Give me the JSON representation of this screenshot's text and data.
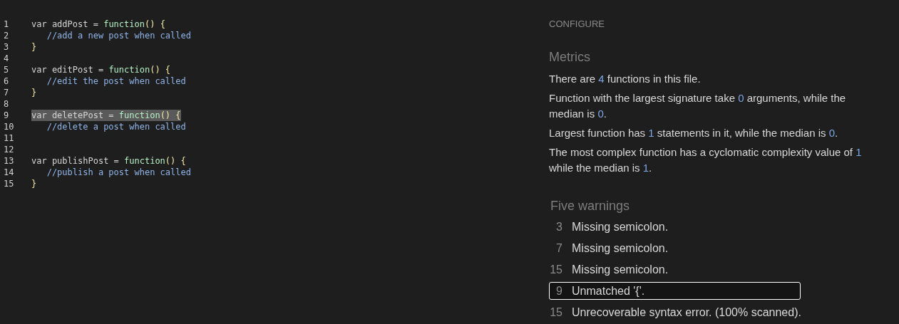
{
  "editor": {
    "lines": [
      {
        "number": "1",
        "selected": false,
        "tokens": [
          {
            "kind": "kw",
            "text": "var addPost = "
          },
          {
            "kind": "fn",
            "text": "function"
          },
          {
            "kind": "br",
            "text": "() {"
          }
        ]
      },
      {
        "number": "2",
        "selected": false,
        "tokens": [
          {
            "kind": "cm",
            "text": "   //add a new post when called"
          }
        ]
      },
      {
        "number": "3",
        "selected": false,
        "tokens": [
          {
            "kind": "br",
            "text": "}"
          }
        ]
      },
      {
        "number": "4",
        "selected": false
      },
      {
        "number": "5",
        "selected": false,
        "tokens": [
          {
            "kind": "kw",
            "text": "var editPost = "
          },
          {
            "kind": "fn",
            "text": "function"
          },
          {
            "kind": "br",
            "text": "() {"
          }
        ]
      },
      {
        "number": "6",
        "selected": false,
        "tokens": [
          {
            "kind": "cm",
            "text": "   //edit the post when called"
          }
        ]
      },
      {
        "number": "7",
        "selected": false,
        "tokens": [
          {
            "kind": "br",
            "text": "}"
          }
        ]
      },
      {
        "number": "8",
        "selected": false
      },
      {
        "number": "9",
        "selected": true,
        "tokens": [
          {
            "kind": "kw",
            "text": "var deletePost = "
          },
          {
            "kind": "fn",
            "text": "function"
          },
          {
            "kind": "br",
            "text": "() {"
          }
        ]
      },
      {
        "number": "10",
        "selected": false,
        "tokens": [
          {
            "kind": "cm",
            "text": "   //delete a post when called"
          }
        ]
      },
      {
        "number": "11",
        "selected": false
      },
      {
        "number": "12",
        "selected": false
      },
      {
        "number": "13",
        "selected": false,
        "tokens": [
          {
            "kind": "kw",
            "text": "var publishPost = "
          },
          {
            "kind": "fn",
            "text": "function"
          },
          {
            "kind": "br",
            "text": "() {"
          }
        ]
      },
      {
        "number": "14",
        "selected": false,
        "tokens": [
          {
            "kind": "cm",
            "text": "   //publish a post when called"
          }
        ]
      },
      {
        "number": "15",
        "selected": false,
        "tokens": [
          {
            "kind": "br",
            "text": "}"
          }
        ]
      }
    ]
  },
  "panel": {
    "configure": "CONFIGURE",
    "metrics_title": "Metrics",
    "metrics": [
      [
        {
          "kind": "text",
          "text": "There are "
        },
        {
          "kind": "num",
          "text": "4"
        },
        {
          "kind": "text",
          "text": " functions in this file."
        }
      ],
      [
        {
          "kind": "text",
          "text": "Function with the largest signature take "
        },
        {
          "kind": "num",
          "text": "0"
        },
        {
          "kind": "text",
          "text": " arguments, while the median is "
        },
        {
          "kind": "num",
          "text": "0"
        },
        {
          "kind": "text",
          "text": "."
        }
      ],
      [
        {
          "kind": "text",
          "text": "Largest function has "
        },
        {
          "kind": "num",
          "text": "1"
        },
        {
          "kind": "text",
          "text": " statements in it, while the median is "
        },
        {
          "kind": "num",
          "text": "0"
        },
        {
          "kind": "text",
          "text": "."
        }
      ],
      [
        {
          "kind": "text",
          "text": "The most complex function has a cyclomatic complexity value of "
        },
        {
          "kind": "num",
          "text": "1"
        },
        {
          "kind": "text",
          "text": " while the median is "
        },
        {
          "kind": "num",
          "text": "1"
        },
        {
          "kind": "text",
          "text": "."
        }
      ]
    ],
    "warnings_title": "Five warnings",
    "warnings": [
      {
        "line": "3",
        "message": "Missing semicolon.",
        "selected": false
      },
      {
        "line": "7",
        "message": "Missing semicolon.",
        "selected": false
      },
      {
        "line": "15",
        "message": "Missing semicolon.",
        "selected": false
      },
      {
        "line": "9",
        "message": "Unmatched '{'.",
        "selected": true
      },
      {
        "line": "15",
        "message": "Unrecoverable syntax error. (100% scanned).",
        "selected": false
      }
    ]
  }
}
